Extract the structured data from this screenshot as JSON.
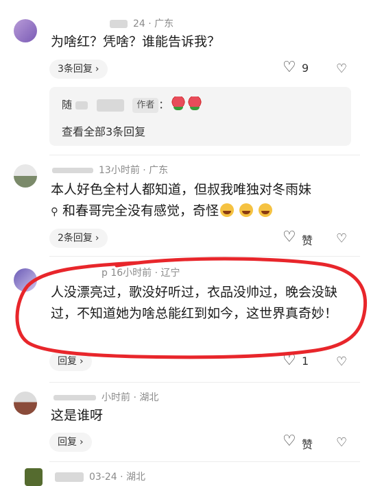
{
  "comment1": {
    "meta": "24 · 广东",
    "text": "为啥红？凭啥？谁能告诉我？",
    "replies_label": "3条回复",
    "likes": "9",
    "reply": {
      "name": "随",
      "author_tag": "作者",
      "text": "："
    },
    "view_all": "查看全部3条回复"
  },
  "comment2": {
    "meta": "13小时前 · 广东",
    "text_line1": "本人好色全村人都知道，但叔我唯独对冬雨妹",
    "search_icon": "search-icon",
    "text_line2": "和春哥完全没有感觉，奇怪",
    "replies_label": "2条回复",
    "likes": "赞"
  },
  "comment3": {
    "meta_prefix": "p",
    "meta": "16小时前 · 辽宁",
    "text": "人没漂亮过，歌没好听过，衣品没帅过，晚会没缺过，不知道她为啥总能红到如今，这世界真奇妙！",
    "reply_label": "回复",
    "likes": "1",
    "highlight_color": "#e8262b"
  },
  "comment4": {
    "meta": "小时前 · 湖北",
    "text": "这是谁呀",
    "reply_label": "回复",
    "likes": "赞"
  },
  "comment5": {
    "meta": "03-24 · 湖北"
  },
  "icons": {
    "heart": "♡",
    "dislike": "♡",
    "chevron": "›"
  }
}
